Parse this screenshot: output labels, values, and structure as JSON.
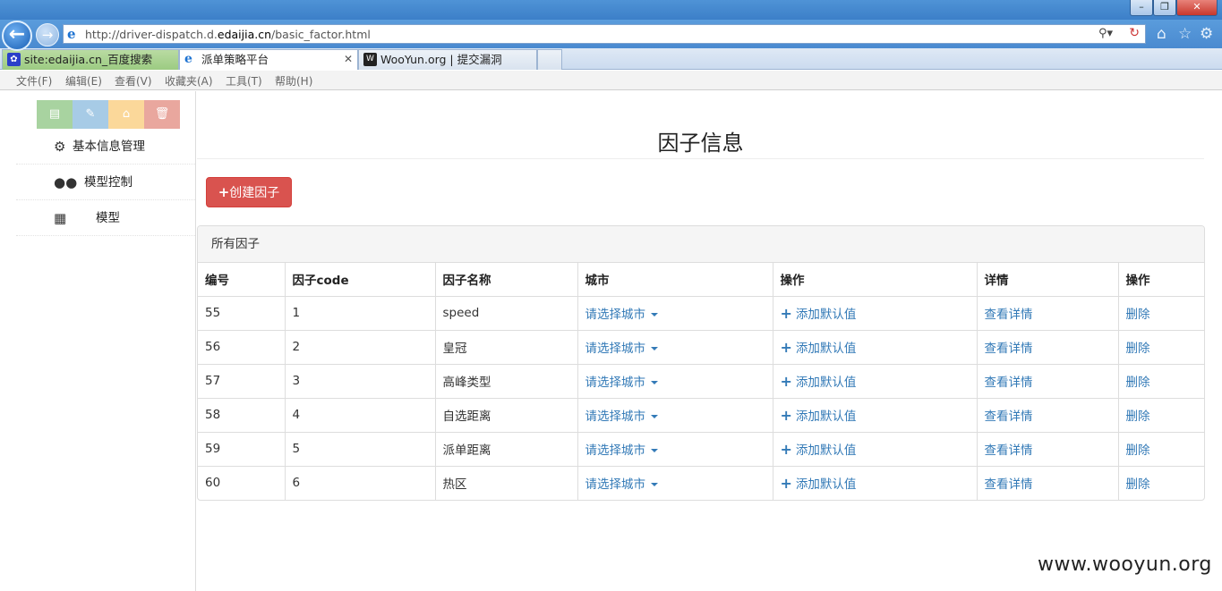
{
  "browser": {
    "url_prefix": "http://driver-dispatch.d.",
    "url_domain": "edaijia.cn",
    "url_suffix": "/basic_factor.html",
    "tabs": [
      {
        "label": "site:edaijia.cn_百度搜索"
      },
      {
        "label": "派单策略平台",
        "active": true
      },
      {
        "label": "WooYun.org | 提交漏洞"
      }
    ],
    "menu": [
      "文件(F)",
      "编辑(E)",
      "查看(V)",
      "收藏夹(A)",
      "工具(T)",
      "帮助(H)"
    ]
  },
  "sidebar": {
    "items": [
      {
        "label": "基本信息管理",
        "icon": "gears-icon"
      },
      {
        "label": "模型控制",
        "icon": "users-icon"
      },
      {
        "label": "模型",
        "icon": "grid-icon"
      }
    ]
  },
  "page": {
    "title": "因子信息",
    "create_button": "创建因子",
    "panel_title": "所有因子"
  },
  "table": {
    "headers": [
      "编号",
      "因子code",
      "因子名称",
      "城市",
      "操作",
      "详情",
      "操作"
    ],
    "city_placeholder": "请选择城市",
    "add_default_label": "添加默认值",
    "detail_label": "查看详情",
    "delete_label": "删除",
    "rows": [
      {
        "id": "55",
        "code": "1",
        "name": "speed"
      },
      {
        "id": "56",
        "code": "2",
        "name": "皇冠"
      },
      {
        "id": "57",
        "code": "3",
        "name": "高峰类型"
      },
      {
        "id": "58",
        "code": "4",
        "name": "自选距离"
      },
      {
        "id": "59",
        "code": "5",
        "name": "派单距离"
      },
      {
        "id": "60",
        "code": "6",
        "name": "热区"
      }
    ]
  },
  "watermark": "www.wooyun.org",
  "colors": {
    "accent_link": "#337ab7",
    "danger_button": "#d9534f",
    "sidebar_buttons": [
      "#a8d3a0",
      "#a7cbe6",
      "#fbd89a",
      "#e9a79e"
    ]
  }
}
